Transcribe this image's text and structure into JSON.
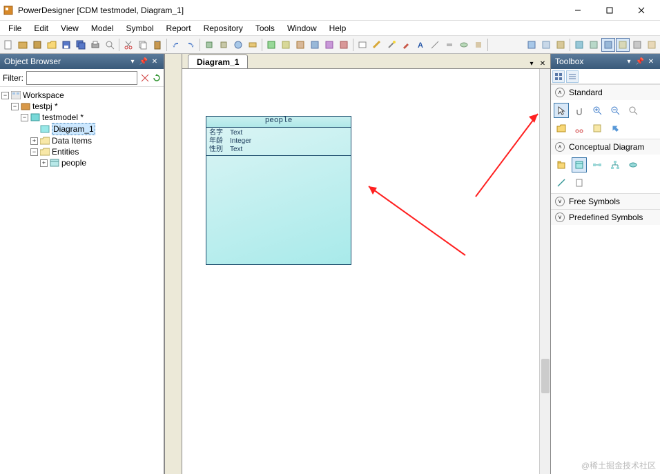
{
  "window": {
    "title": "PowerDesigner [CDM testmodel, Diagram_1]"
  },
  "menu": [
    "File",
    "Edit",
    "View",
    "Model",
    "Symbol",
    "Report",
    "Repository",
    "Tools",
    "Window",
    "Help"
  ],
  "object_browser": {
    "title": "Object Browser",
    "filter_label": "Filter:",
    "filter_value": "",
    "tree": {
      "workspace": "Workspace",
      "project": "testpj *",
      "model": "testmodel *",
      "diagram": "Diagram_1",
      "data_items": "Data Items",
      "entities": "Entities",
      "entity_people": "people"
    }
  },
  "canvas": {
    "tab": "Diagram_1",
    "entity": {
      "name": "people",
      "attrs": [
        {
          "name": "名字",
          "type": "Text"
        },
        {
          "name": "年龄",
          "type": "Integer"
        },
        {
          "name": "性别",
          "type": "Text"
        }
      ]
    }
  },
  "toolbox": {
    "title": "Toolbox",
    "sections": {
      "standard": "Standard",
      "conceptual": "Conceptual Diagram",
      "free": "Free Symbols",
      "predefined": "Predefined Symbols"
    }
  },
  "watermark": "@稀土掘金技术社区"
}
